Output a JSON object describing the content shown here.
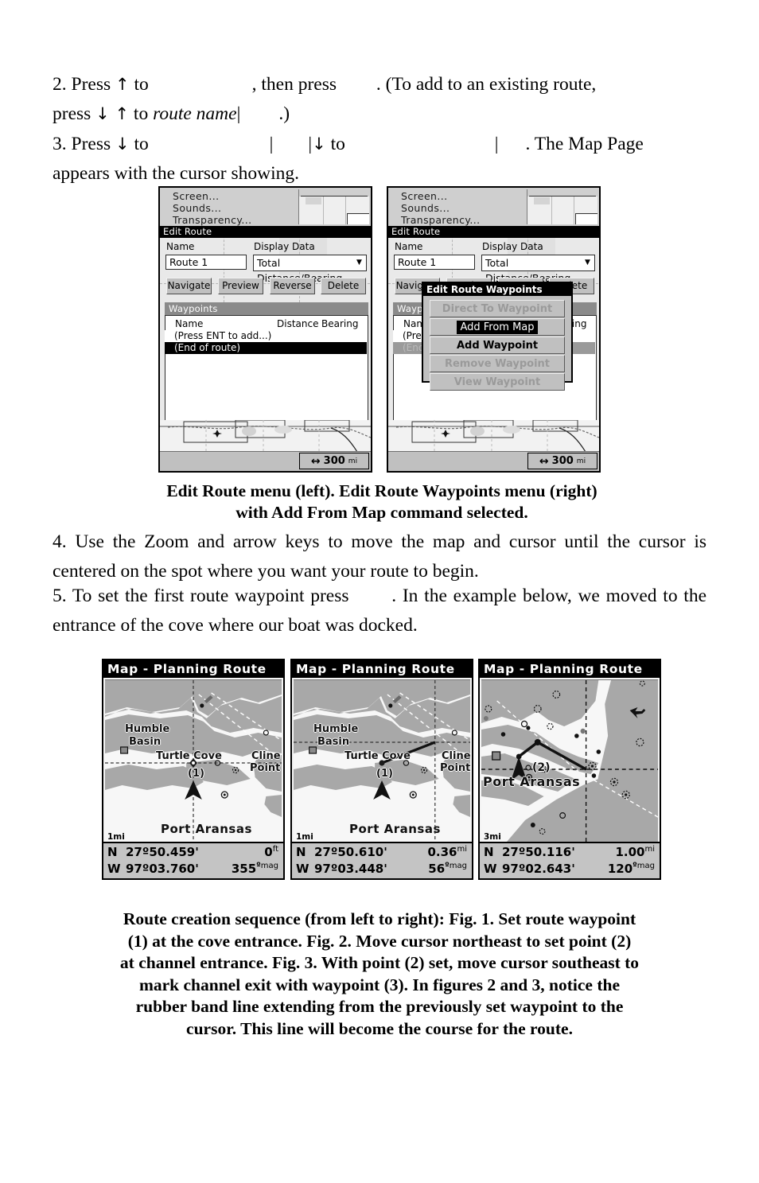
{
  "body_text": {
    "step2_line1_a": "2. Press ",
    "step2_arrow_up": "↑",
    "step2_line1_b": " to ",
    "step2_line1_c": ", then press ",
    "step2_line1_d": ". (To add to an existing route,",
    "step2_line2_a": "press ",
    "step2_line2_arrows": "↓ ↑",
    "step2_line2_b": " to ",
    "step2_line2_italic": "route name",
    "step2_line2_pipe": "|",
    "step2_line2_c": ".)",
    "step3_line1_a": "3. Press ",
    "step3_arrow_down": "↓",
    "step3_line1_b": " to ",
    "step3_pipe1": "|",
    "step3_pipe2": "|",
    "step3_arrow_down2": "↓",
    "step3_line1_c": " to ",
    "step3_pipe3": "|",
    "step3_line1_d": ". The Map Page",
    "step3_line2": "appears with the cursor showing.",
    "step4": "4. Use the Zoom and arrow keys to move the map and cursor until the cursor is centered on the spot where you want your route to begin.",
    "step5_a": "5. To set the first route waypoint press ",
    "step5_b": ". In the example below, we moved to the entrance of the cove where our boat was docked."
  },
  "caption1": {
    "line1": "Edit Route menu (left). Edit Route Waypoints menu (right)",
    "line2": "with Add From Map command selected."
  },
  "caption2": {
    "line1": "Route creation sequence (from left to right): Fig. 1. Set route waypoint",
    "line2": "(1) at the cove entrance. Fig. 2. Move cursor northeast to set point (2)",
    "line3": "at channel entrance. Fig. 3. With point (2) set, move cursor southeast to",
    "line4": "mark channel exit with waypoint (3). In figures 2 and 3, notice the",
    "line5": "rubber band line extending from the previously set waypoint to the",
    "line6": "cursor. This line will become the course for the route."
  },
  "edit_route_screen": {
    "top_menu": [
      "Screen...",
      "Sounds...",
      "Transparency..."
    ],
    "window_title": "Edit Route",
    "name_label": "Name",
    "name_value": "Route 1",
    "display_data_label": "Display Data",
    "display_data_value": "Total Distance/Bearing",
    "dropdown_icon": "▼",
    "buttons": [
      "Navigate",
      "Preview",
      "Reverse",
      "Delete"
    ],
    "waypoints_section": "Waypoints",
    "col_name": "Name",
    "col_distance": "Distance",
    "col_bearing": "Bearing",
    "rows": [
      "(Press ENT to add...)",
      "(End of route)"
    ],
    "zoom_value": "300",
    "zoom_unit": "mi",
    "zoom_icon": "↔"
  },
  "waypoints_popup": {
    "title": "Edit Route Waypoints",
    "items": [
      {
        "label": "Direct To Waypoint",
        "state": "disabled"
      },
      {
        "label": "Add From Map",
        "state": "selected"
      },
      {
        "label": "Add Waypoint",
        "state": "enabled"
      },
      {
        "label": "Remove Waypoint",
        "state": "disabled"
      },
      {
        "label": "View Waypoint",
        "state": "disabled"
      }
    ]
  },
  "map_figures": [
    {
      "title": "Map - Planning Route",
      "scale": "1mi",
      "place_labels": [
        "Humble",
        "Basin",
        "Turtle Cove",
        "Cline",
        "Point",
        "Port Aransas"
      ],
      "waypoint_label": "(1)",
      "lat_dir": "N",
      "lat": "27º50.459'",
      "lon_dir": "W",
      "lon": "97º03.760'",
      "dist_value": "0",
      "dist_unit": "ft",
      "bearing_value": "355",
      "bearing_deg": "º",
      "bearing_unit": "mag"
    },
    {
      "title": "Map - Planning Route",
      "scale": "1mi",
      "place_labels": [
        "Humble",
        "Basin",
        "Turtle Cove",
        "Cline",
        "Point",
        "Port Aransas"
      ],
      "waypoint_label": "(1)",
      "lat_dir": "N",
      "lat": "27º50.610'",
      "lon_dir": "W",
      "lon": "97º03.448'",
      "dist_value": "0.36",
      "dist_unit": "mi",
      "bearing_value": "56",
      "bearing_deg": "º",
      "bearing_unit": "mag"
    },
    {
      "title": "Map - Planning Route",
      "scale": "3mi",
      "place_labels": [
        "Port Aransas"
      ],
      "waypoint_label": "(2)",
      "lat_dir": "N",
      "lat": "27º50.116'",
      "lon_dir": "W",
      "lon": "97º02.643'",
      "dist_value": "1.00",
      "dist_unit": "mi",
      "bearing_value": "120",
      "bearing_deg": "º",
      "bearing_unit": "mag"
    }
  ],
  "colors": {
    "land": "#a8a8a8",
    "water": "#f7f7f7",
    "black": "#000000",
    "lcd_gray": "#c0c0c0"
  }
}
